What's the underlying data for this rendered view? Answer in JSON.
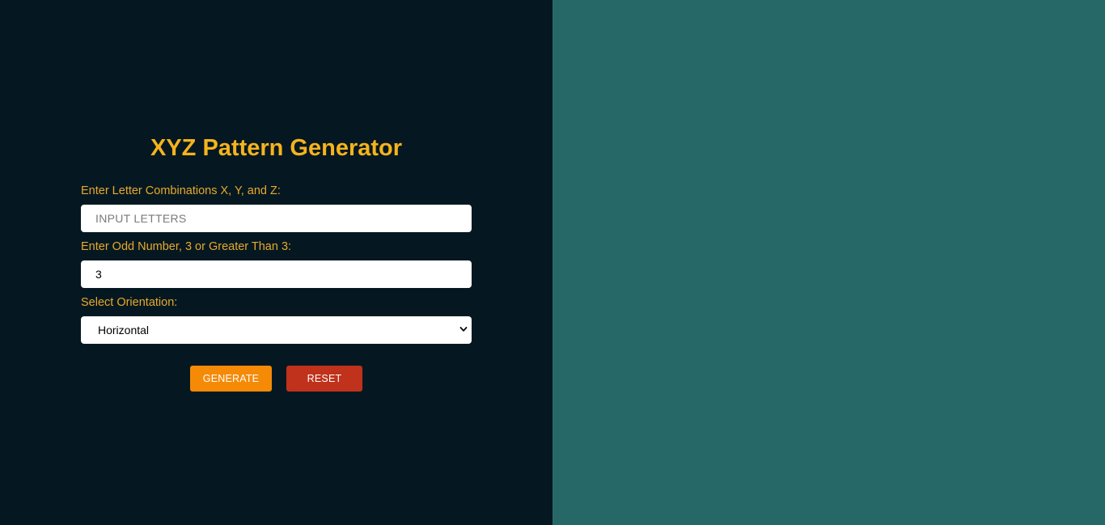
{
  "app": {
    "title": "XYZ Pattern Generator"
  },
  "form": {
    "letters_label": "Enter Letter Combinations X, Y, and Z:",
    "letters_placeholder": "INPUT LETTERS",
    "letters_value": "",
    "number_label": "Enter Odd Number, 3 or Greater Than 3:",
    "number_value": "3",
    "orientation_label": "Select Orientation:",
    "orientation_value": "Horizontal",
    "chevron_icon": "chevron-down-icon"
  },
  "actions": {
    "generate_label": "GENERATE",
    "reset_label": "RESET"
  },
  "colors": {
    "left_panel_bg": "#051821",
    "right_panel_bg": "#266867",
    "title_color": "#f5b31e",
    "label_color": "#e8a92a",
    "generate_bg": "#f58a07",
    "reset_bg": "#c0321b"
  }
}
